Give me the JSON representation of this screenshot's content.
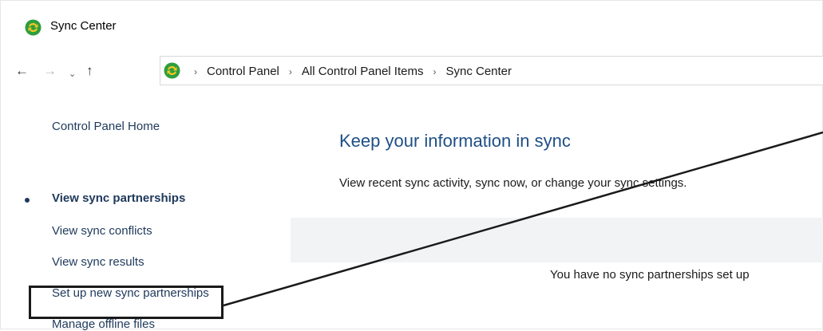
{
  "window": {
    "title": "Sync Center"
  },
  "nav": {
    "back_glyph": "←",
    "forward_glyph": "→",
    "recent_glyph": "⌄",
    "up_glyph": "↑",
    "separator": "›",
    "breadcrumbs": [
      "Control Panel",
      "All Control Panel Items",
      "Sync Center"
    ]
  },
  "sidebar": {
    "home": "Control Panel Home",
    "items": [
      {
        "label": "View sync partnerships",
        "active": true
      },
      {
        "label": "View sync conflicts"
      },
      {
        "label": "View sync results"
      },
      {
        "label": "Set up new sync partnerships"
      },
      {
        "label": "Manage offline files"
      }
    ]
  },
  "main": {
    "title": "Keep your information in sync",
    "description": "View recent sync activity, sync now, or change your sync settings.",
    "empty_message": "You have no sync partnerships set up"
  },
  "icons": {
    "app": "sync-center-icon"
  },
  "colors": {
    "link": "#1e395b",
    "heading": "#1e4f86",
    "icon_green": "#2e9e3e",
    "icon_yellow": "#f3c623"
  }
}
